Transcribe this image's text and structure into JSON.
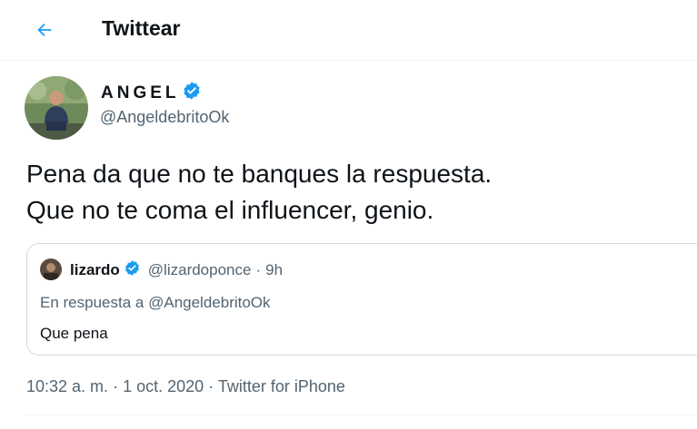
{
  "header": {
    "title": "Twittear",
    "back_icon": "arrow-left-icon"
  },
  "author": {
    "name": "ANGEL",
    "handle": "@AngeldebritoOk",
    "verified": true
  },
  "tweet": {
    "line1": "Pena da que no te banques la respuesta.",
    "line2": "Que no te coma el influencer, genio."
  },
  "quote": {
    "name": "lizardo",
    "verified": true,
    "handle": "@lizardoponce",
    "separator": "·",
    "time": "9h",
    "reply_prefix": "En respuesta a",
    "reply_mention": "@AngeldebritoOk",
    "text": "Que pena"
  },
  "meta": {
    "time": "10:32 a. m.",
    "separator": "·",
    "date": "1 oct. 2020",
    "source": "Twitter for iPhone"
  },
  "colors": {
    "accent": "#1d9bf0",
    "secondary_text": "#536471",
    "primary_text": "#0f1419"
  }
}
